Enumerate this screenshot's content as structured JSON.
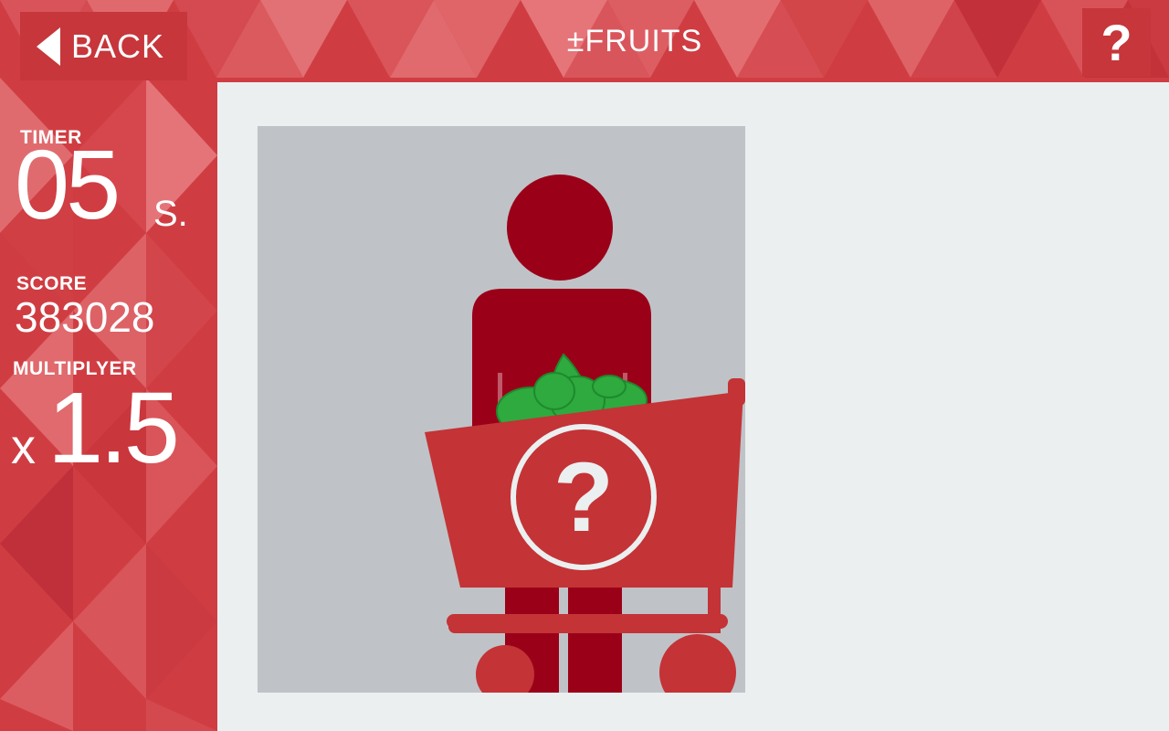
{
  "header": {
    "back_label": "BACK",
    "title": "±FRUITS",
    "help_label": "?"
  },
  "stats": {
    "timer_label": "TIMER",
    "timer_value": "05",
    "timer_unit": "S.",
    "score_label": "SCORE",
    "score_value": "383028",
    "multiplier_label": "MULTIPLYER",
    "multiplier_prefix": "x",
    "multiplier_value": "1.5"
  },
  "puzzle": {
    "image": "person-with-shopping-cart-icon",
    "cart_symbol": "?"
  },
  "colors": {
    "accent_red": "#c8373c",
    "dark_red": "#9b0019",
    "cart_red": "#c43336",
    "leaf_green": "#2eaa3f",
    "panel_bg": "#ebeff0",
    "card_bg": "#bfc3c7"
  }
}
